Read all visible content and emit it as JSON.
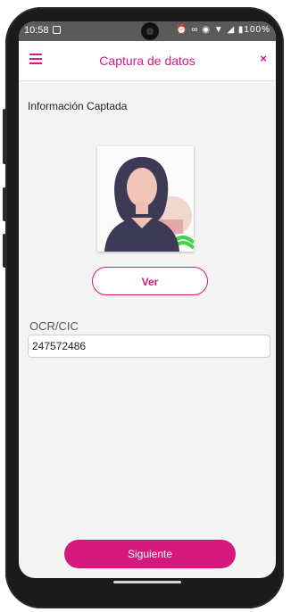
{
  "status_bar": {
    "time": "10:58",
    "right_icons": "⏰ ∞ ◉ ▼ ◢ ▮100%"
  },
  "app_bar": {
    "title": "Captura de datos",
    "menu_icon": "hamburger-menu-icon",
    "close_icon": "close-icon",
    "close_glyph": "×"
  },
  "section": {
    "label": "Información Captada"
  },
  "photo": {
    "icon": "id-photo-avatar"
  },
  "ver_button": {
    "label": "Ver"
  },
  "ocr_field": {
    "label": "OCR/CIC",
    "value": "247572486"
  },
  "next_button": {
    "label": "Siguiente"
  },
  "colors": {
    "accent": "#d4187c",
    "background": "#f4f4f4",
    "status_bar": "#5a5a5a"
  }
}
